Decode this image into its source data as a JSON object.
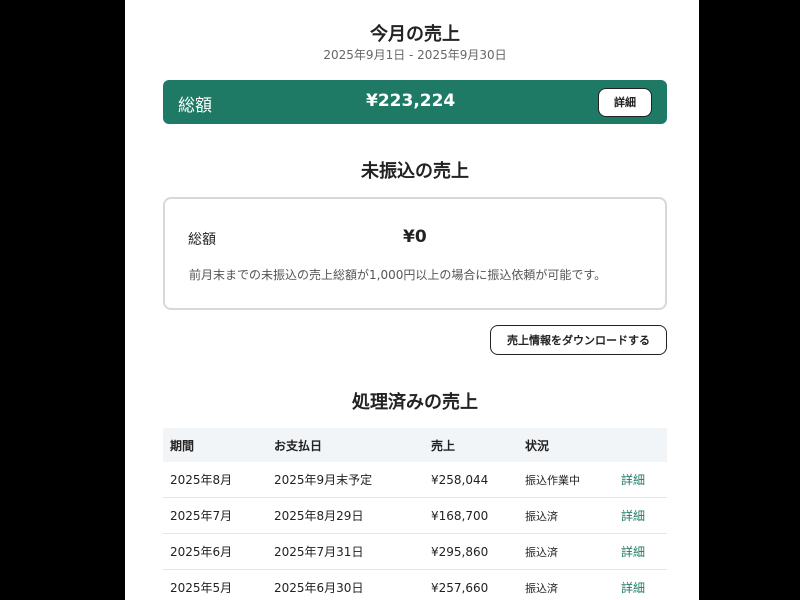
{
  "current": {
    "title": "今月の売上",
    "period": "2025年9月1日 - 2025年9月30日",
    "total_label": "総額",
    "total_amount": "¥223,224",
    "detail_button": "詳細"
  },
  "unpaid": {
    "title": "未振込の売上",
    "total_label": "総額",
    "total_amount": "¥0",
    "note": "前月末までの未振込の売上総額が1,000円以上の場合に振込依頼が可能です。"
  },
  "download_button": "売上情報をダウンロードする",
  "processed": {
    "title": "処理済みの売上",
    "columns": [
      "期間",
      "お支払日",
      "売上",
      "状況",
      ""
    ],
    "rows": [
      {
        "period": "2025年8月",
        "pay_date": "2025年9月末予定",
        "sales": "¥258,044",
        "status": "振込作業中",
        "detail": "詳細"
      },
      {
        "period": "2025年7月",
        "pay_date": "2025年8月29日",
        "sales": "¥168,700",
        "status": "振込済",
        "detail": "詳細"
      },
      {
        "period": "2025年6月",
        "pay_date": "2025年7月31日",
        "sales": "¥295,860",
        "status": "振込済",
        "detail": "詳細"
      },
      {
        "period": "2025年5月",
        "pay_date": "2025年6月30日",
        "sales": "¥257,660",
        "status": "振込済",
        "detail": "詳細"
      }
    ]
  },
  "colors": {
    "accent": "#1f7a65",
    "table_header_bg": "#f2f5f8",
    "backdrop": "#000000"
  }
}
